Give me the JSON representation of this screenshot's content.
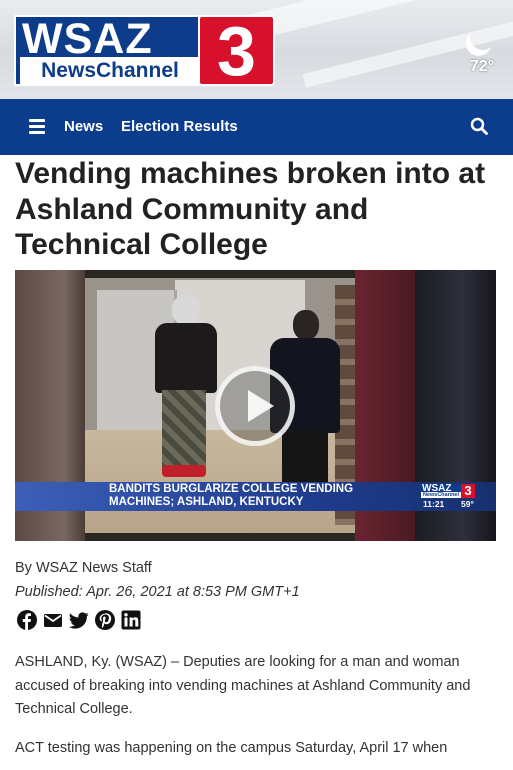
{
  "header": {
    "logo": {
      "wsaz": "WSAZ",
      "newschannel": "NewsChannel",
      "number": "3"
    },
    "weather": {
      "icon": "moon-icon",
      "temperature": "72°"
    }
  },
  "nav": {
    "menu_icon": "hamburger-menu-icon",
    "links": [
      "News",
      "Election Results"
    ],
    "search_icon": "search-icon"
  },
  "article": {
    "headline": "Vending machines broken into at Ashland Community and Technical College",
    "video": {
      "lower_third": "BANDITS BURGLARIZE COLLEGE VENDING MACHINES; ASHLAND, KENTUCKY",
      "mini_logo_wsaz": "WSAZ",
      "mini_logo_nc": "NewsChannel",
      "mini_logo_3": "3",
      "time": "11:21",
      "temp": "59°"
    },
    "byline": "By WSAZ News Staff",
    "published": "Published: Apr. 26, 2021 at 8:53 PM GMT+1",
    "share_icons": [
      "facebook-icon",
      "email-icon",
      "twitter-icon",
      "pinterest-icon",
      "linkedin-icon"
    ],
    "paragraphs": [
      "ASHLAND, Ky. (WSAZ) – Deputies are looking for a man and woman accused of breaking into vending machines at Ashland Community and Technical College.",
      "ACT testing was happening on the campus Saturday, April 17 when"
    ]
  },
  "colors": {
    "brand_blue": "#0c3d8c",
    "brand_red": "#d7102b"
  }
}
